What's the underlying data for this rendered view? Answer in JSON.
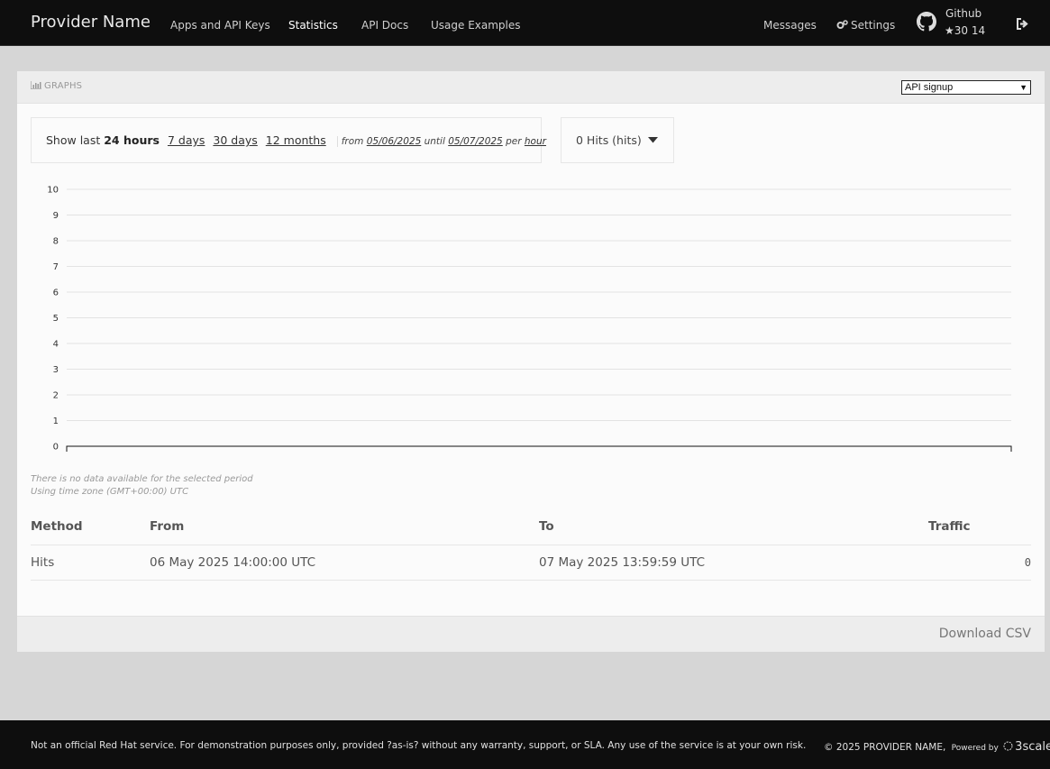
{
  "header": {
    "brand": "Provider Name",
    "nav": [
      {
        "label": "Apps and API Keys",
        "active": false
      },
      {
        "label": "Statistics",
        "active": true
      },
      {
        "label": "API Docs",
        "active": false
      },
      {
        "label": "Usage Examples",
        "active": false
      }
    ],
    "right_nav": {
      "messages": "Messages",
      "settings": "Settings",
      "github_label": "Github",
      "github_stats": "30 14"
    }
  },
  "panel": {
    "title": "GRAPHS",
    "metric_select": "API signup",
    "period": {
      "show_last": "Show last",
      "current": "24 hours",
      "options": [
        "7 days",
        "30 days",
        "12 months"
      ],
      "from_label": "from",
      "from_date": "05/06/2025",
      "until_label": "until",
      "until_date": "05/07/2025",
      "per_label": "per",
      "per_unit": "hour"
    },
    "hits_dropdown": "0 Hits (hits)",
    "empty_note": "There is no data available for the selected period",
    "timezone_note": "Using time zone (GMT+00:00) UTC",
    "download": "Download CSV"
  },
  "chart_data": {
    "type": "line",
    "y_ticks": [
      0,
      1,
      2,
      3,
      4,
      5,
      6,
      7,
      8,
      9,
      10
    ],
    "ylim": [
      0,
      10
    ],
    "series": [],
    "grid": true
  },
  "table": {
    "headers": [
      "Method",
      "From",
      "To",
      "Traffic"
    ],
    "rows": [
      {
        "method": "Hits",
        "from": "06 May 2025 14:00:00 UTC",
        "to": "07 May 2025 13:59:59 UTC",
        "traffic": "0"
      }
    ]
  },
  "footer": {
    "disclaimer": "Not an official Red Hat service. For demonstration purposes only, provided ?as-is? without any warranty, support, or SLA. Any use of the service is at your own risk.",
    "copyright": "© 2025 PROVIDER NAME,",
    "powered_by": "Powered by",
    "powered_brand": "3scale"
  },
  "colors": {
    "topbar": "#0e0e0e",
    "page_bg": "#d6d6d6",
    "panel_bg": "#fbfbfb"
  }
}
